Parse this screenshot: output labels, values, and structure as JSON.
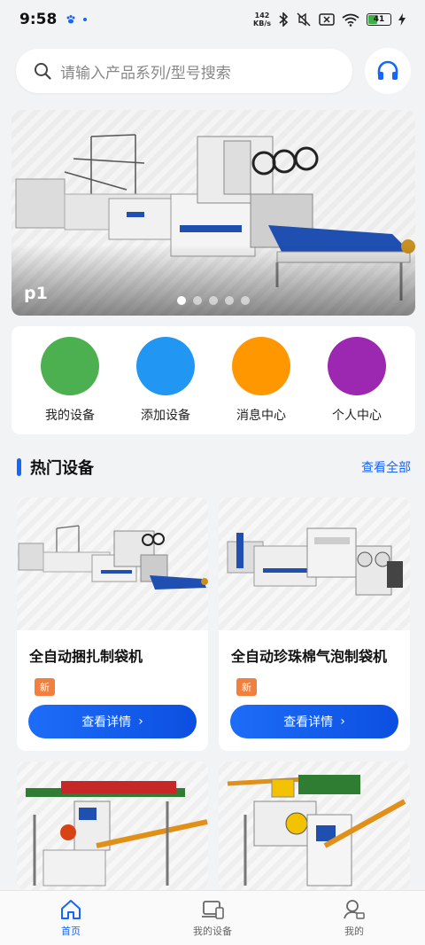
{
  "status": {
    "time": "9:58",
    "net_speed_value": "142",
    "net_speed_unit": "KB/s",
    "battery_text": "41",
    "battery_level": 0.41,
    "icons": [
      "paw-icon",
      "dot-icon",
      "bluetooth-icon",
      "mute-icon",
      "sim-x-icon",
      "wifi-icon",
      "battery-icon",
      "charging-icon"
    ]
  },
  "search": {
    "placeholder": "请输入产品系列/型号搜索"
  },
  "banner": {
    "label": "p1",
    "slide_count": 5,
    "active_index": 0
  },
  "quick_actions": [
    {
      "label": "我的设备",
      "color": "#4caf50"
    },
    {
      "label": "添加设备",
      "color": "#2196f3"
    },
    {
      "label": "消息中心",
      "color": "#ff9800"
    },
    {
      "label": "个人中心",
      "color": "#9c27b0"
    }
  ],
  "hot": {
    "title": "热门设备",
    "more": "查看全部",
    "products": [
      {
        "name": "全自动捆扎制袋机",
        "tag": "新",
        "button": "查看详情"
      },
      {
        "name": "全自动珍珠棉气泡制袋机",
        "tag": "新",
        "button": "查看详情"
      },
      {
        "name": "",
        "tag": "",
        "button": ""
      },
      {
        "name": "",
        "tag": "",
        "button": ""
      }
    ]
  },
  "nav": [
    {
      "label": "首页",
      "active": true
    },
    {
      "label": "我的设备",
      "active": false
    },
    {
      "label": "我的",
      "active": false
    }
  ],
  "colors": {
    "accent": "#1565ff",
    "tag": "#f27f3d",
    "machine_blue": "#1f4fb0"
  }
}
